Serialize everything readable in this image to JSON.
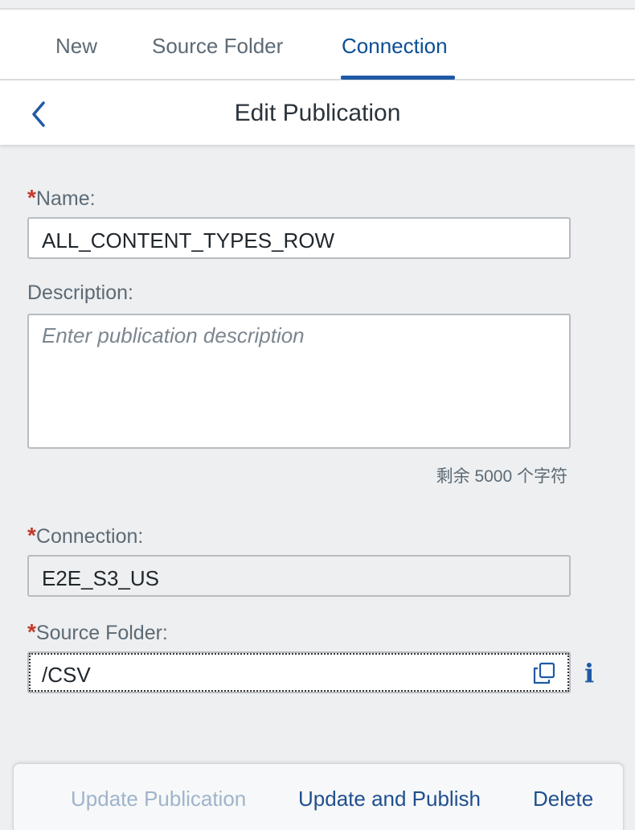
{
  "tabs": [
    {
      "label": "New",
      "active": false
    },
    {
      "label": "Source Folder",
      "active": false
    },
    {
      "label": "Connection",
      "active": true
    }
  ],
  "header": {
    "title": "Edit Publication",
    "back_icon": "chevron-left-icon"
  },
  "form": {
    "required_marker": "*",
    "name": {
      "label": "Name:",
      "value": "ALL_CONTENT_TYPES_ROW"
    },
    "description": {
      "label": "Description:",
      "placeholder": "Enter publication description",
      "counter": "剩余 5000 个字符"
    },
    "connection": {
      "label": "Connection:",
      "value": "E2E_S3_US"
    },
    "source_folder": {
      "label": "Source Folder:",
      "value": "/CSV",
      "action_icon": "copy-icon",
      "info_glyph": "i"
    }
  },
  "footer": {
    "update_label": "Update Publication",
    "update_publish_label": "Update and Publish",
    "delete_label": "Delete"
  },
  "colors": {
    "accent": "#0a4e94",
    "required": "#c23a2b",
    "disabled": "#9fb4cb"
  }
}
